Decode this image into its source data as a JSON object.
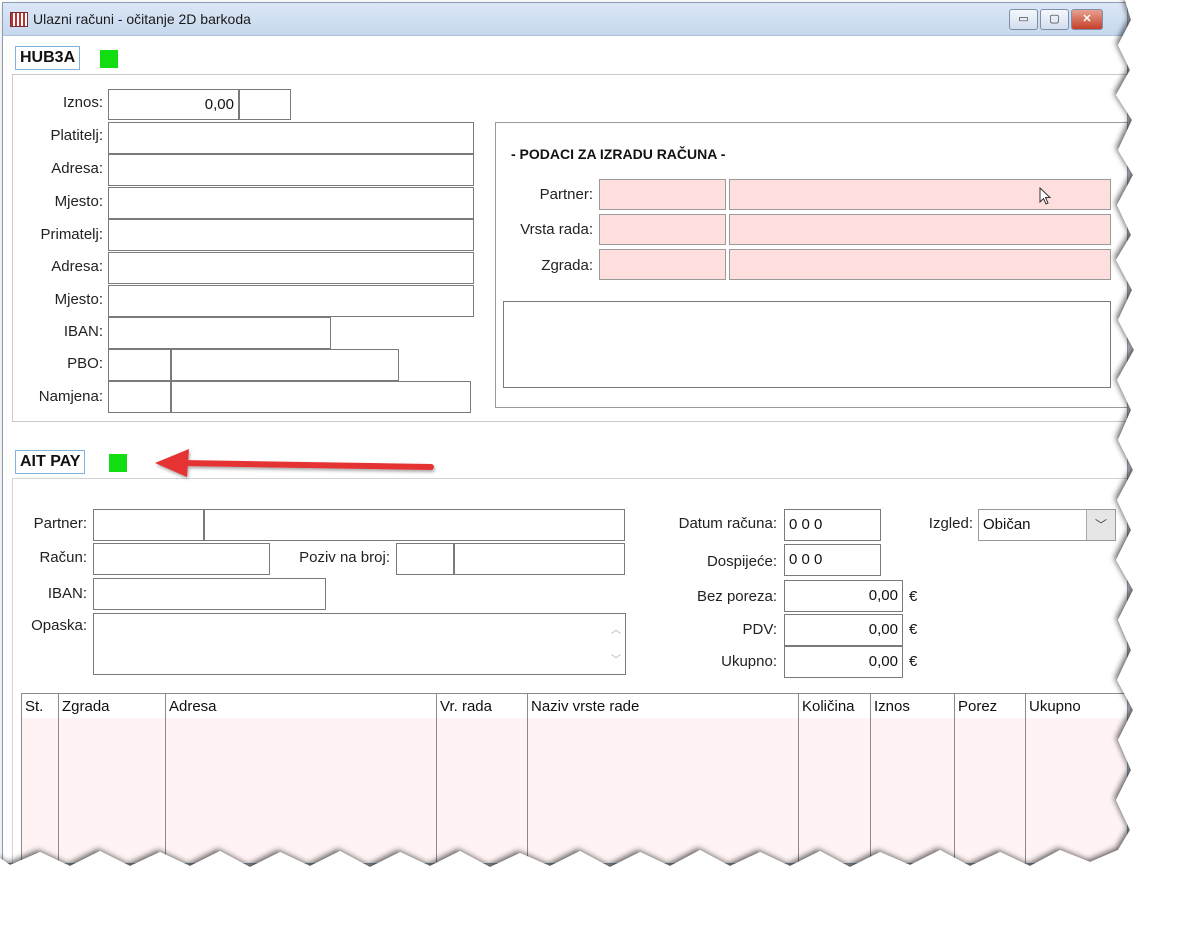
{
  "window": {
    "title": "Ulazni računi - očitanje 2D barkoda",
    "min_glyph": "▭",
    "max_glyph": "▢",
    "close_glyph": "✕"
  },
  "hub3a": {
    "tag": "HUB3A",
    "status_color": "#11dd11",
    "labels": {
      "iznos": "Iznos:",
      "platitelj": "Platitelj:",
      "adresa1": "Adresa:",
      "mjesto1": "Mjesto:",
      "primatelj": "Primatelj:",
      "adresa2": "Adresa:",
      "mjesto2": "Mjesto:",
      "iban": "IBAN:",
      "pbo": "PBO:",
      "namjena": "Namjena:"
    },
    "iznos_value": "0,00"
  },
  "podaci": {
    "heading": "- PODACI ZA IZRADU RAČUNA -",
    "partner_label": "Partner:",
    "vrsta_label": "Vrsta rada:",
    "zgrada_label": "Zgrada:"
  },
  "aitpay": {
    "tag": "AIT PAY",
    "status_color": "#11dd11",
    "partner_label": "Partner:",
    "racun_label": "Račun:",
    "poziv_label": "Poziv na broj:",
    "iban_label": "IBAN:",
    "opaska_label": "Opaska:",
    "datum_label": "Datum računa:",
    "datum_value": "0 0  0",
    "dospijece_label": "Dospijeće:",
    "dospijece_value": "0 0  0",
    "bez_poreza_label": "Bez poreza:",
    "bez_poreza_value": "0,00",
    "pdv_label": "PDV:",
    "pdv_value": "0,00",
    "ukupno_label": "Ukupno:",
    "ukupno_value": "0,00",
    "currency": "€",
    "izgled_label": "Izgled:",
    "izgled_value": "Običan"
  },
  "table": {
    "columns": [
      "St.",
      "Zgrada",
      "Adresa",
      "Vr. rada",
      "Naziv vrste rade",
      "Količina",
      "Iznos",
      "Porez",
      "Ukupno"
    ]
  },
  "annotation": {
    "arrow_color": "#e53333"
  }
}
